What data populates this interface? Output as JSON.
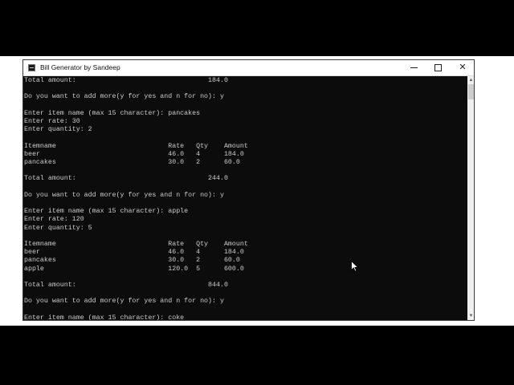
{
  "window": {
    "title": "Bill Generator by Sandeep"
  },
  "console": {
    "lines": [
      "Total amount:                                 184.0",
      "",
      "Do you want to add more(y for yes and n for no): y",
      "",
      "Enter item name (max 15 character): pancakes",
      "Enter rate: 30",
      "Enter quantity: 2",
      "",
      "Itemname                            Rate   Qty    Amount",
      "beer                                46.0   4      184.0",
      "pancakes                            30.0   2      60.0",
      "",
      "Total amount:                                 244.0",
      "",
      "Do you want to add more(y for yes and n for no): y",
      "",
      "Enter item name (max 15 character): apple",
      "Enter rate: 120",
      "Enter quantity: 5",
      "",
      "Itemname                            Rate   Qty    Amount",
      "beer                                46.0   4      184.0",
      "pancakes                            30.0   2      60.0",
      "apple                               120.0  5      600.0",
      "",
      "Total amount:                                 844.0",
      "",
      "Do you want to add more(y for yes and n for no): y",
      "",
      "Enter item name (max 15 character): coke"
    ]
  },
  "colors": {
    "console_bg": "#0c0c0c",
    "console_text": "#cccccc",
    "titlebar_bg": "#ffffff"
  },
  "icons": {
    "app": "console-app-icon",
    "minimize": "minimize-icon",
    "maximize": "maximize-icon",
    "close": "close-icon"
  }
}
